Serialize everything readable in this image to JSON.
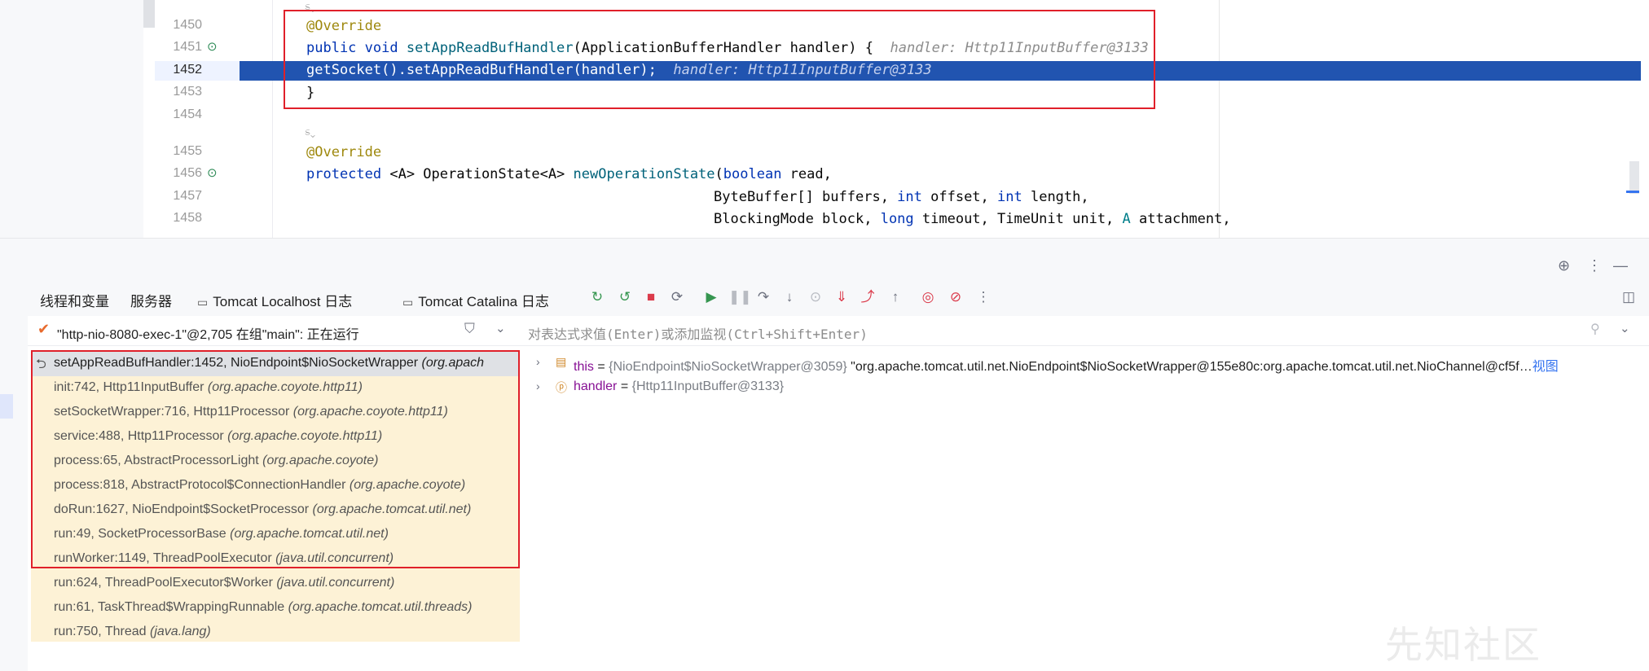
{
  "editor": {
    "lines": [
      {
        "no": "1450"
      },
      {
        "no": "1451"
      },
      {
        "no": "1452"
      },
      {
        "no": "1453"
      },
      {
        "no": "1454"
      },
      {
        "no": "1455"
      },
      {
        "no": "1456"
      },
      {
        "no": "1457"
      },
      {
        "no": "1458"
      }
    ],
    "lens1": "ಽ⌄",
    "lens2": "ಽ⌄",
    "code": {
      "l1450_ann": "@Override",
      "l1451_kw": "public void ",
      "l1451_fn": "setAppReadBufHandler",
      "l1451_rest": "(ApplicationBufferHandler handler) {",
      "l1451_hint": "handler: Http11InputBuffer@3133",
      "l1452_code": "getSocket().setAppReadBufHandler(handler);",
      "l1452_hint": "handler: Http11InputBuffer@3133",
      "l1453": "}",
      "l1455_ann": "@Override",
      "l1456_kw": "protected ",
      "l1456_a": "<A> OperationState<A> ",
      "l1456_fn": "newOperationState",
      "l1456_p": "(",
      "l1456_bool": "boolean",
      "l1456_rest": " read,",
      "l1457_a": "ByteBuffer[] buffers, ",
      "l1457_int1": "int",
      "l1457_b": " offset, ",
      "l1457_int2": "int",
      "l1457_c": " length,",
      "l1458_a": "BlockingMode block, ",
      "l1458_long": "long",
      "l1458_b": " timeout, TimeUnit unit, ",
      "l1458_A": "A",
      "l1458_c": " attachment,"
    }
  },
  "debug": {
    "tabs": [
      {
        "label": "线程和变量"
      },
      {
        "label": "服务器"
      },
      {
        "label": "Tomcat Localhost 日志"
      },
      {
        "label": "Tomcat Catalina 日志"
      }
    ],
    "thread": "\"http-nio-8080-exec-1\"@2,705 在组\"main\": 正在运行",
    "frames": [
      {
        "method": "setAppReadBufHandler:1452, NioEndpoint$NioSocketWrapper",
        "pkg": "(org.apach"
      },
      {
        "method": "init:742, Http11InputBuffer",
        "pkg": "(org.apache.coyote.http11)"
      },
      {
        "method": "setSocketWrapper:716, Http11Processor",
        "pkg": "(org.apache.coyote.http11)"
      },
      {
        "method": "service:488, Http11Processor",
        "pkg": "(org.apache.coyote.http11)"
      },
      {
        "method": "process:65, AbstractProcessorLight",
        "pkg": "(org.apache.coyote)"
      },
      {
        "method": "process:818, AbstractProtocol$ConnectionHandler",
        "pkg": "(org.apache.coyote)"
      },
      {
        "method": "doRun:1627, NioEndpoint$SocketProcessor",
        "pkg": "(org.apache.tomcat.util.net)"
      },
      {
        "method": "run:49, SocketProcessorBase",
        "pkg": "(org.apache.tomcat.util.net)"
      },
      {
        "method": "runWorker:1149, ThreadPoolExecutor",
        "pkg": "(java.util.concurrent)"
      },
      {
        "method": "run:624, ThreadPoolExecutor$Worker",
        "pkg": "(java.util.concurrent)"
      },
      {
        "method": "run:61, TaskThread$WrappingRunnable",
        "pkg": "(org.apache.tomcat.util.threads)"
      },
      {
        "method": "run:750, Thread",
        "pkg": "(java.lang)"
      }
    ],
    "expression_placeholder": "对表达式求值(Enter)或添加监视(Ctrl+Shift+Enter)",
    "vars": {
      "this_name": "this",
      "this_eq": " = ",
      "this_type": "{NioEndpoint$NioSocketWrapper@3059}",
      "this_value": " \"org.apache.tomcat.util.net.NioEndpoint$NioSocketWrapper@155e80c:org.apache.tomcat.util.net.NioChannel@cf5f…",
      "this_view": "视图",
      "handler_name": "handler",
      "handler_eq": " = ",
      "handler_type": "{Http11InputBuffer@3133}"
    },
    "watermark": "先知社区"
  },
  "colors": {
    "exec_line": "#2154b0",
    "highlight_box": "#e0202a",
    "frames_bg": "#fdf2d6",
    "keyword": "#0033b3",
    "annotation": "#9e880d"
  },
  "icons": [
    "override-icon",
    "rerun-icon",
    "stop-icon",
    "resume-icon",
    "pause-icon",
    "step-over-icon",
    "step-into-icon",
    "step-out-icon",
    "breakpoints-icon",
    "mute-breakpoints-icon",
    "more-icon",
    "filter-icon",
    "chevron-down-icon",
    "layout-icon",
    "target-icon",
    "minimize-icon"
  ]
}
